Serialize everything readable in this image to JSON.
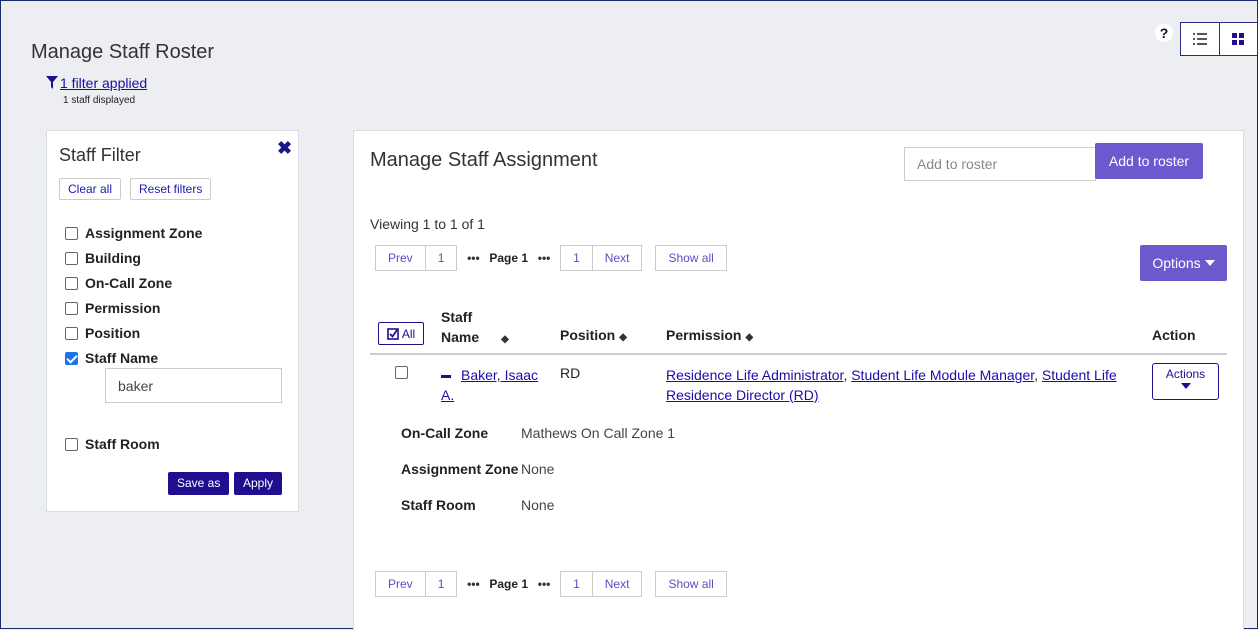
{
  "page": {
    "title": "Manage Staff Roster",
    "filter_link": "1 filter applied",
    "staff_displayed": "1 staff displayed",
    "help": "?"
  },
  "filter_panel": {
    "title": "Staff Filter",
    "clear_all": "Clear all",
    "reset_filters": "Reset filters",
    "options": [
      {
        "label": "Assignment Zone",
        "checked": false
      },
      {
        "label": "Building",
        "checked": false
      },
      {
        "label": "On-Call Zone",
        "checked": false
      },
      {
        "label": "Permission",
        "checked": false
      },
      {
        "label": "Position",
        "checked": false
      },
      {
        "label": "Staff Name",
        "checked": true
      },
      {
        "label": "Staff Room",
        "checked": false
      }
    ],
    "staff_name_value": "baker",
    "save_as": "Save as",
    "apply": "Apply"
  },
  "main": {
    "title": "Manage Staff Assignment",
    "roster_placeholder": "Add to roster",
    "add_to_roster": "Add to roster",
    "viewing": "Viewing 1 to 1 of 1",
    "options": "Options",
    "pager": {
      "prev": "Prev",
      "first": "1",
      "dots": "•••",
      "current": "Page 1",
      "last": "1",
      "next": "Next",
      "show_all": "Show all"
    },
    "table": {
      "all_label": "All",
      "col_staff_line1": "Staff",
      "col_staff_line2": "Name",
      "col_position": "Position",
      "col_permission": "Permission",
      "col_action": "Action",
      "row": {
        "name_line1": "Baker, Isaac",
        "name_line2": "A.",
        "position": "RD",
        "permission_1": "Residence Life Administrator",
        "permission_2": "Student Life Module Manager",
        "permission_3a": "Student Life",
        "permission_3b": "Residence Director (RD)",
        "actions": "Actions"
      },
      "details": [
        {
          "label": "On-Call Zone",
          "value": "Mathews On Call Zone 1"
        },
        {
          "label": "Assignment Zone",
          "value": "None"
        },
        {
          "label": "Staff Room",
          "value": "None"
        }
      ]
    }
  },
  "colors": {
    "accent_purple": "#6a5acd",
    "dark_button": "#1f0f8f",
    "link": "#1a0dab",
    "checkbox_checked": "#1a73e8"
  }
}
